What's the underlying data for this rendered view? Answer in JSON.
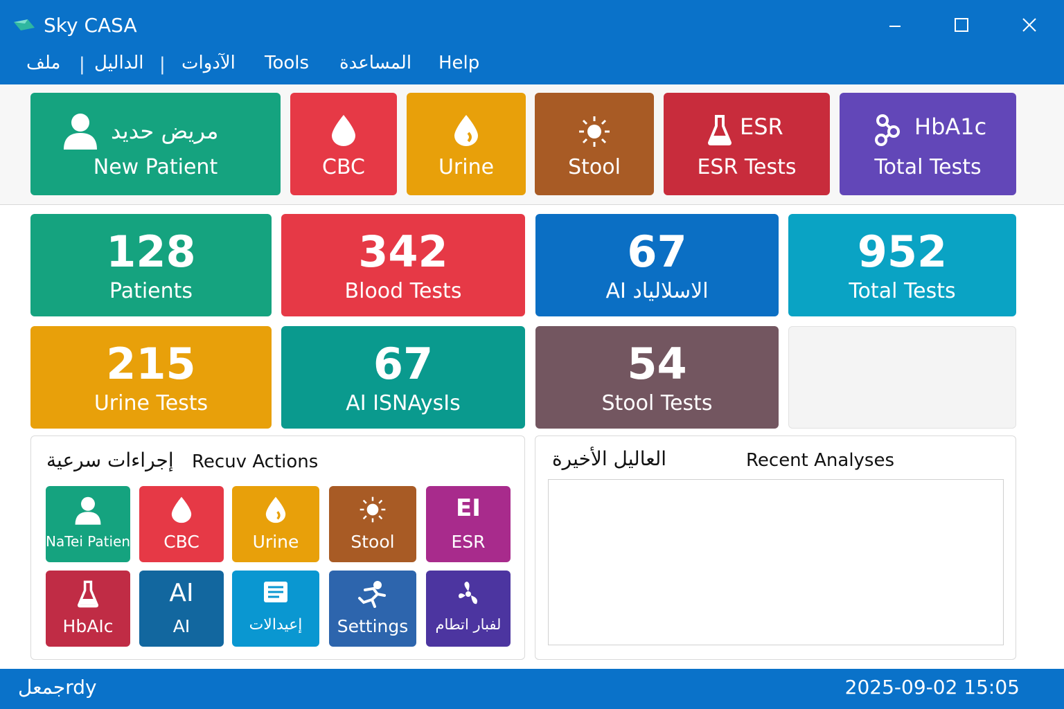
{
  "app": {
    "title": "Sky CASA"
  },
  "menu": {
    "items": [
      "ملف",
      "الداليل",
      "الآدوات",
      "Tools",
      "المساعدة",
      "Help"
    ],
    "separator": "|"
  },
  "toolbar": {
    "new_patient": {
      "label_ar": "مريض حديد",
      "label_en": "New Patient",
      "color": "#15a37f",
      "icon": "user-icon"
    },
    "cbc": {
      "label": "CBC",
      "color": "#e63946",
      "icon": "blood-drop-icon"
    },
    "urine": {
      "label": "Urine",
      "color": "#e8a00a",
      "icon": "urine-drop-icon"
    },
    "stool": {
      "label": "Stool",
      "color": "#a85b25",
      "icon": "sun-icon"
    },
    "esr": {
      "label_top": "ESR",
      "label_bot": "ESR Tests",
      "color": "#c82c3c",
      "icon": "flask-icon"
    },
    "hba1c": {
      "label_top": "HbA1c",
      "label_bot": "Total Tests",
      "color": "#6247b8",
      "icon": "molecule-icon"
    }
  },
  "stats": [
    {
      "value": "128",
      "label": "Patients",
      "color": "#15a37f"
    },
    {
      "value": "342",
      "label": "Blood Tests",
      "color": "#e63946"
    },
    {
      "value": "67",
      "label": "AI الاسلالياد",
      "color": "#0b6fc4"
    },
    {
      "value": "952",
      "label": "Total Tests",
      "color": "#0aa3c4"
    },
    {
      "value": "215",
      "label": "Urine Tests",
      "color": "#e8a00a"
    },
    {
      "value": "67",
      "label": "AI ISNAysIs",
      "color": "#0a9a8e"
    },
    {
      "value": "54",
      "label": "Stool Tests",
      "color": "#735660"
    }
  ],
  "quick_actions": {
    "title_ar": "إجراءات سرعية",
    "title_en": "Recuv Actions",
    "items": [
      {
        "label": "NaTei Patient",
        "color": "#15a37f",
        "icon": "user-icon"
      },
      {
        "label": "CBC",
        "color": "#e63946",
        "icon": "blood-drop-icon"
      },
      {
        "label": "Urine",
        "color": "#e8a00a",
        "icon": "urine-drop-icon"
      },
      {
        "label": "Stool",
        "color": "#a85b25",
        "icon": "sun-icon"
      },
      {
        "label": "ESR",
        "big": "EI",
        "color": "#a82b8c",
        "icon": "esr-icon"
      },
      {
        "label": "HbAIc",
        "color": "#c02c45",
        "icon": "flask-icon"
      },
      {
        "label": "AI",
        "big": "AI",
        "color": "#12679f",
        "icon": "ai-icon"
      },
      {
        "label": "إعيدالات",
        "color": "#0a97d1",
        "icon": "document-icon"
      },
      {
        "label": "Settings",
        "color": "#2d65ad",
        "icon": "runner-icon"
      },
      {
        "label": "لفبار اتطام",
        "color": "#4c35a0",
        "icon": "fan-icon"
      }
    ]
  },
  "recent": {
    "title_ar": "العاليل الأخيرة",
    "title_en": "Recent Analyses"
  },
  "status": {
    "left": "جمعلrdy",
    "datetime": "2025-09-02 15:05"
  }
}
